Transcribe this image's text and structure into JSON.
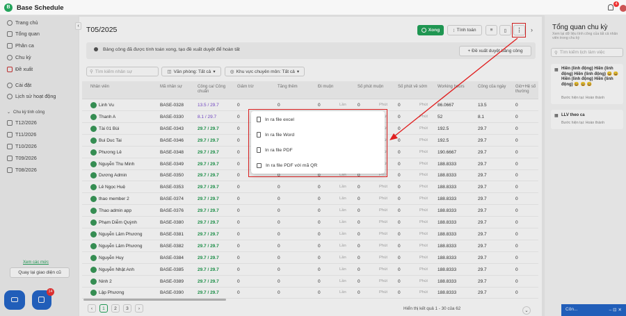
{
  "app": {
    "title": "Base Schedule",
    "logo": "B",
    "notif_count": "4"
  },
  "sidebar": {
    "items": [
      {
        "label": "Trang chủ",
        "icon": "clock-icon"
      },
      {
        "label": "Tổng quan",
        "icon": "grid-icon"
      },
      {
        "label": "Phân ca",
        "icon": "calendar-icon"
      },
      {
        "label": "Chu kỳ",
        "icon": "cycle-icon"
      },
      {
        "label": "Đề xuất",
        "icon": "proposal-icon"
      },
      {
        "label": "Cài đặt",
        "icon": "settings-icon"
      },
      {
        "label": "Lịch sử hoạt động",
        "icon": "history-icon"
      }
    ],
    "group_label": "Chu kỳ tính công",
    "periods": [
      "T12/2026",
      "T11/2026",
      "T10/2026",
      "T09/2026",
      "T08/2026"
    ],
    "more_link": "Xem các mức",
    "back_button": "Quay lại giao diện cũ",
    "chat_badge": "14"
  },
  "main": {
    "title": "T05/2025",
    "done_button": "Xong",
    "calc_button": "Tính toán",
    "banner": "Bảng công đã được tính toán xong, tạo đề xuất duyệt để hoàn tất",
    "propose_button": "+ Đề xuất duyệt bảng công",
    "search_placeholder": "Tìm kiếm nhân sự",
    "office_filter": "Văn phòng: Tất cả",
    "area_filter": "Khu vực chuyên môn: Tất cả",
    "columns": [
      "Nhân viên",
      "Mã nhân sự",
      "Công ca/ Công chuẩn",
      "Giảm trừ",
      "Tăng thêm",
      "Đi muộn",
      "Số phút muộn",
      "Số phút về sớm",
      "Working hours",
      "Công của ngày",
      "Giờ+Hệ số thường"
    ],
    "rows": [
      [
        "Linh Vu",
        "BASE-0328",
        "13.5 / 29.7",
        "0",
        "0",
        "0",
        "Lần",
        "0",
        "Phút",
        "0",
        "Phút",
        "86.0667",
        "13.5",
        "0"
      ],
      [
        "Thanh A",
        "BASE-0330",
        "8.1 / 29.7",
        "0",
        "0",
        "0",
        "Lần",
        "0",
        "Phút",
        "0",
        "Phút",
        "52",
        "8.1",
        "0"
      ],
      [
        "Tài 01 Bùi",
        "BASE-0343",
        "29.7 / 29.7",
        "0",
        "0",
        "0",
        "Lần",
        "0",
        "Phút",
        "0",
        "Phút",
        "192.5",
        "29.7",
        "0"
      ],
      [
        "Bui Duc Tai",
        "BASE-0346",
        "29.7 / 29.7",
        "0",
        "0",
        "0",
        "Lần",
        "0",
        "Phút",
        "0",
        "Phút",
        "192.5",
        "29.7",
        "0"
      ],
      [
        "Phương Lê",
        "BASE-0348",
        "29.7 / 29.7",
        "0",
        "0",
        "0",
        "Lần",
        "0",
        "Phút",
        "0",
        "Phút",
        "190.6667",
        "29.7",
        "0"
      ],
      [
        "Nguyễn Thu Minh",
        "BASE-0349",
        "29.7 / 29.7",
        "0",
        "0",
        "0",
        "Lần",
        "0",
        "Phút",
        "0",
        "Phút",
        "188.8333",
        "29.7",
        "0"
      ],
      [
        "Dương Admin",
        "BASE-0350",
        "29.7 / 29.7",
        "0",
        "0",
        "0",
        "Lần",
        "0",
        "Phút",
        "0",
        "Phút",
        "188.8333",
        "29.7",
        "0"
      ],
      [
        "Lê Ngọc Huệ",
        "BASE-0353",
        "29.7 / 29.7",
        "0",
        "0",
        "0",
        "Lần",
        "0",
        "Phút",
        "0",
        "Phút",
        "188.8333",
        "29.7",
        "0"
      ],
      [
        "thao member 2",
        "BASE-0374",
        "29.7 / 29.7",
        "0",
        "0",
        "0",
        "Lần",
        "0",
        "Phút",
        "0",
        "Phút",
        "188.8333",
        "29.7",
        "0"
      ],
      [
        "Thao admin app",
        "BASE-0376",
        "29.7 / 29.7",
        "0",
        "0",
        "0",
        "Lần",
        "0",
        "Phút",
        "0",
        "Phút",
        "188.8333",
        "29.7",
        "0"
      ],
      [
        "Phạm Diễm Quỳnh",
        "BASE-0380",
        "29.7 / 29.7",
        "0",
        "0",
        "0",
        "Lần",
        "0",
        "Phút",
        "0",
        "Phút",
        "188.8333",
        "29.7",
        "0"
      ],
      [
        "Nguyễn Lâm Phương",
        "BASE-0381",
        "29.7 / 29.7",
        "0",
        "0",
        "0",
        "Lần",
        "0",
        "Phút",
        "0",
        "Phút",
        "188.8333",
        "29.7",
        "0"
      ],
      [
        "Nguyễn Lâm Phương",
        "BASE-0382",
        "29.7 / 29.7",
        "0",
        "0",
        "0",
        "Lần",
        "0",
        "Phút",
        "0",
        "Phút",
        "188.8333",
        "29.7",
        "0"
      ],
      [
        "Nguyễn Huy",
        "BASE-0384",
        "29.7 / 29.7",
        "0",
        "0",
        "0",
        "Lần",
        "0",
        "Phút",
        "0",
        "Phút",
        "188.8333",
        "29.7",
        "0"
      ],
      [
        "Nguyễn Nhật Anh",
        "BASE-0385",
        "29.7 / 29.7",
        "0",
        "0",
        "0",
        "Lần",
        "0",
        "Phút",
        "0",
        "Phút",
        "188.8333",
        "29.7",
        "0"
      ],
      [
        "Ninh 2",
        "BASE-0389",
        "29.7 / 29.7",
        "0",
        "0",
        "0",
        "Lần",
        "0",
        "Phút",
        "0",
        "Phút",
        "188.8333",
        "29.7",
        "0"
      ],
      [
        "Lập Phương",
        "BASE-0390",
        "29.7 / 29.7",
        "0",
        "0",
        "0",
        "Lần",
        "0",
        "Phút",
        "0",
        "Phút",
        "188.8333",
        "29.7",
        "0"
      ]
    ],
    "pagination": {
      "pages": [
        "1",
        "2",
        "3"
      ],
      "summary": "Hiển thị kết quả 1 - 30 của 62"
    }
  },
  "menu": {
    "items": [
      "In ra file excel",
      "In ra file Word",
      "In ra file PDF",
      "In ra file PDF với mã QR"
    ]
  },
  "right": {
    "title": "Tổng quan chu kỳ",
    "subtitle": "Xem lại dữ liệu tính công của tất cả nhân viên trong chu kỳ",
    "search_placeholder": "Tìm kiếm lịch làm việc",
    "card1_title": "Hiền (linh động) Hiền (linh động) Hiền (linh động) 😀 😀 Hiền (linh động) Hiền (linh động) 😀 😀 😀",
    "card1_sub": "Bước hiện tại: Hoàn thành",
    "card2_title": "LLV theo ca",
    "card2_sub": "Bước hiện tại: Hoàn thành",
    "chat_label": "Côn..."
  },
  "colors": {
    "accent": "#22a35a",
    "highlight": "#e02020"
  }
}
